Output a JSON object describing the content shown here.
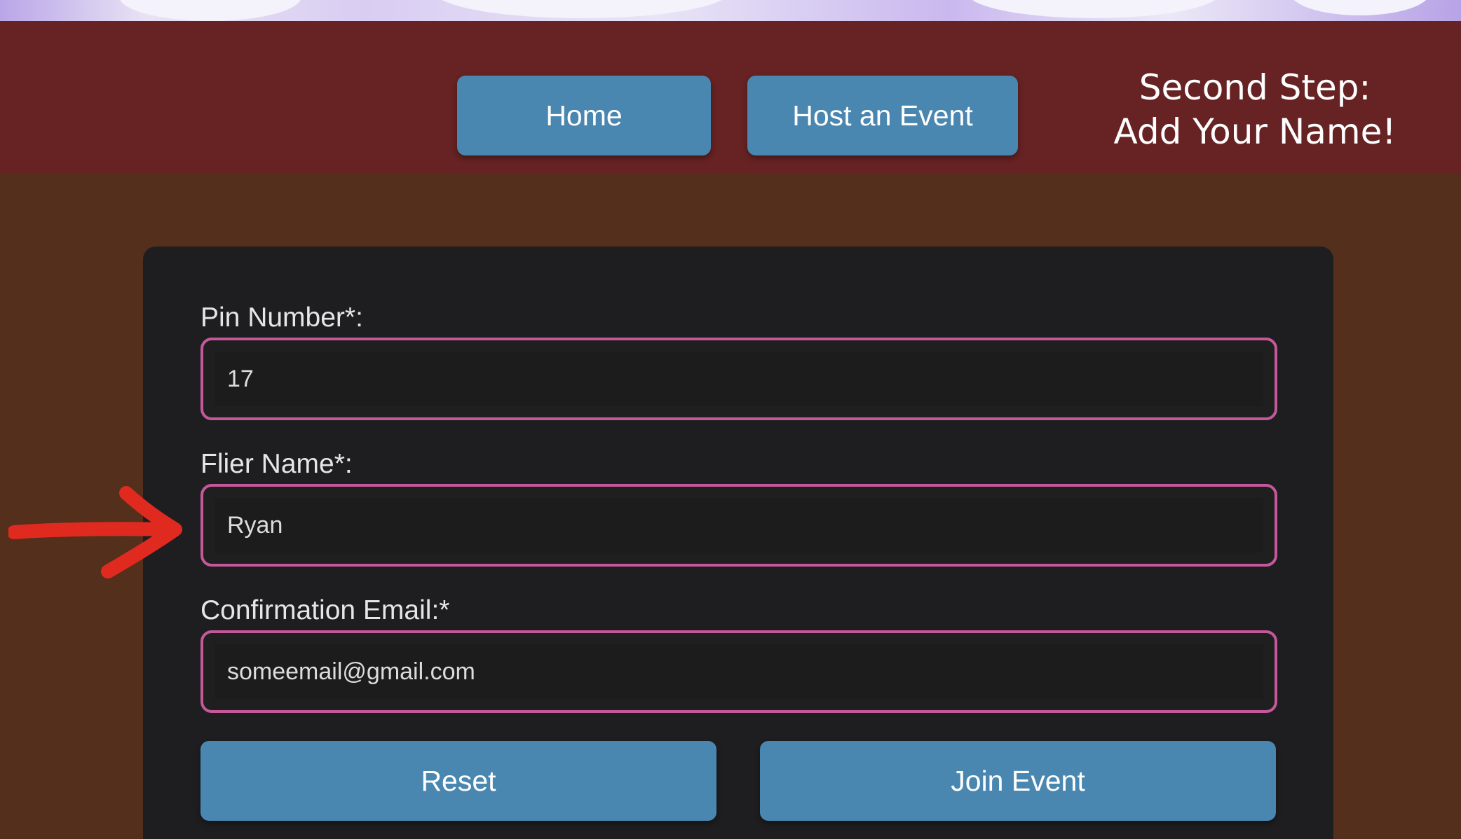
{
  "nav": {
    "home_label": "Home",
    "host_label": "Host an Event"
  },
  "step_note": {
    "line1": "Second Step:",
    "line2": "Add Your Name!"
  },
  "form": {
    "pin": {
      "label": "Pin Number*:",
      "value": "17"
    },
    "flier_name": {
      "label": "Flier Name*:",
      "value": "Ryan"
    },
    "email": {
      "label": "Confirmation Email:*",
      "value": "someemail@gmail.com"
    },
    "reset_label": "Reset",
    "join_label": "Join Event"
  },
  "colors": {
    "header_bg": "#672223",
    "page_bg": "#54301c",
    "button_bg": "#4a87b0",
    "input_border": "#c5589a",
    "arrow": "#e02a1f"
  },
  "annotation": {
    "icon": "red-arrow-icon"
  }
}
